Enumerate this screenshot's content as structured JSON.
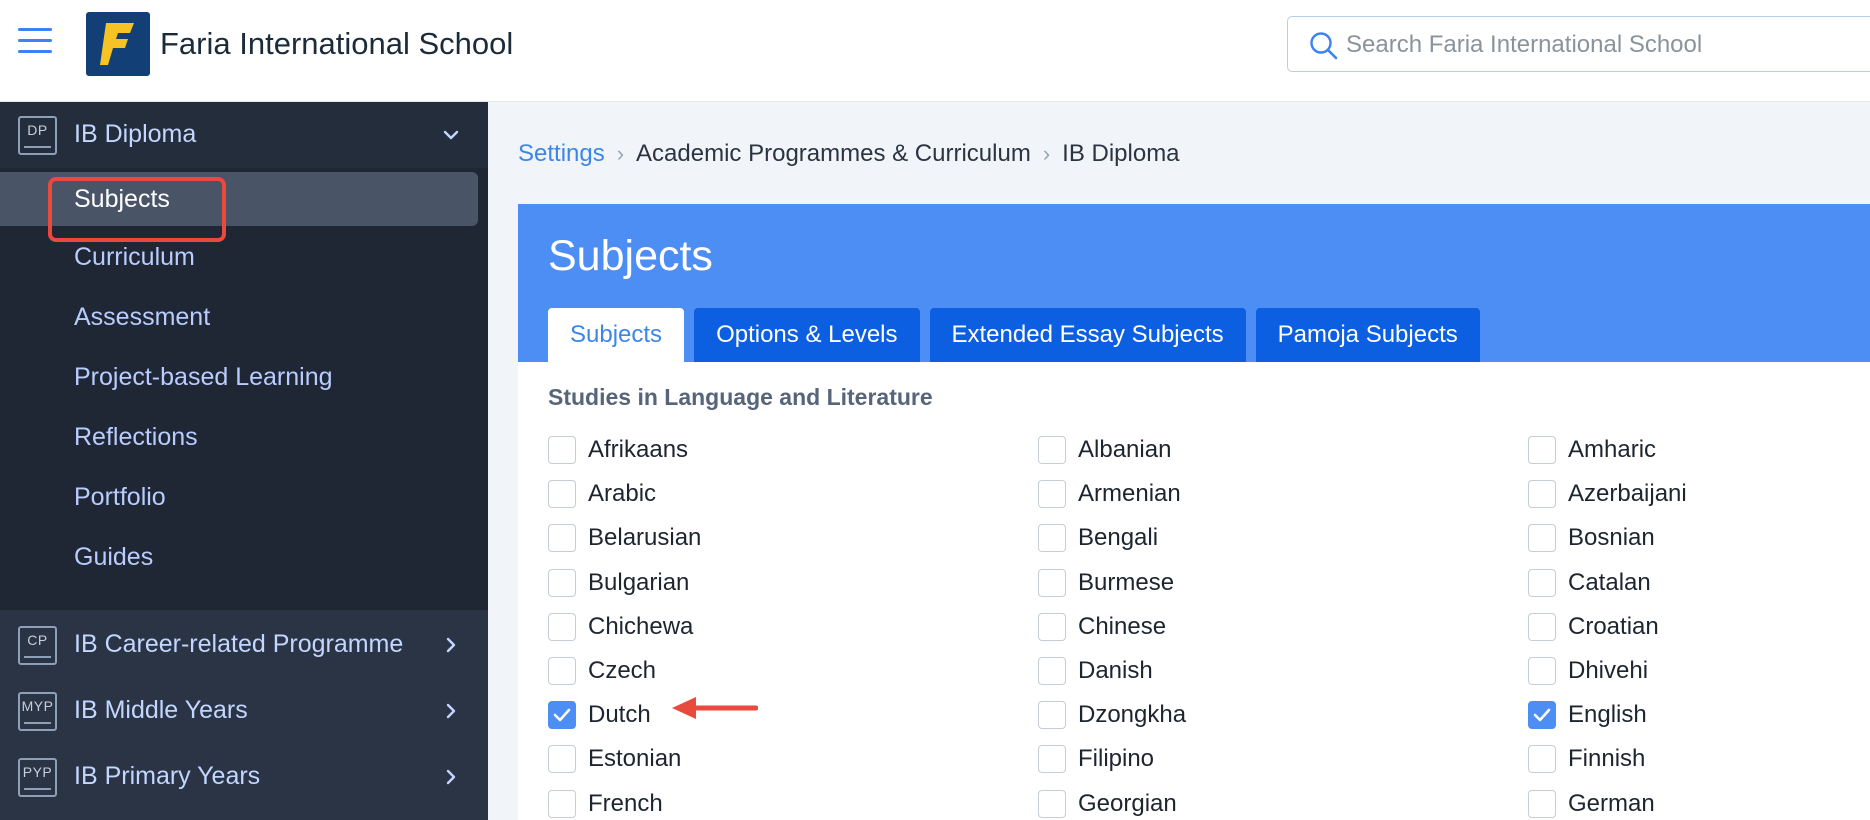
{
  "header": {
    "school_name": "Faria International School",
    "search_placeholder": "Search Faria International School"
  },
  "sidebar": {
    "programmes": [
      {
        "badge": "DP",
        "label": "IB Diploma",
        "expanded": true
      },
      {
        "badge": "CP",
        "label": "IB Career-related Programme",
        "expanded": false
      },
      {
        "badge": "MYP",
        "label": "IB Middle Years",
        "expanded": false
      },
      {
        "badge": "PYP",
        "label": "IB Primary Years",
        "expanded": false
      }
    ],
    "diploma_items": [
      "Subjects",
      "Curriculum",
      "Assessment",
      "Project-based Learning",
      "Reflections",
      "Portfolio",
      "Guides"
    ],
    "active_item": "Subjects"
  },
  "breadcrumb": {
    "items": [
      "Settings",
      "Academic Programmes & Curriculum",
      "IB Diploma"
    ]
  },
  "panel": {
    "title": "Subjects",
    "tabs": [
      "Subjects",
      "Options & Levels",
      "Extended Essay Subjects",
      "Pamoja Subjects"
    ],
    "active_tab": "Subjects",
    "section_title": "Studies in Language and Literature",
    "columns": [
      [
        {
          "label": "Afrikaans",
          "checked": false
        },
        {
          "label": "Arabic",
          "checked": false
        },
        {
          "label": "Belarusian",
          "checked": false
        },
        {
          "label": "Bulgarian",
          "checked": false
        },
        {
          "label": "Chichewa",
          "checked": false
        },
        {
          "label": "Czech",
          "checked": false
        },
        {
          "label": "Dutch",
          "checked": true
        },
        {
          "label": "Estonian",
          "checked": false
        },
        {
          "label": "French",
          "checked": false
        }
      ],
      [
        {
          "label": "Albanian",
          "checked": false
        },
        {
          "label": "Armenian",
          "checked": false
        },
        {
          "label": "Bengali",
          "checked": false
        },
        {
          "label": "Burmese",
          "checked": false
        },
        {
          "label": "Chinese",
          "checked": false
        },
        {
          "label": "Danish",
          "checked": false
        },
        {
          "label": "Dzongkha",
          "checked": false
        },
        {
          "label": "Filipino",
          "checked": false
        },
        {
          "label": "Georgian",
          "checked": false
        }
      ],
      [
        {
          "label": "Amharic",
          "checked": false
        },
        {
          "label": "Azerbaijani",
          "checked": false
        },
        {
          "label": "Bosnian",
          "checked": false
        },
        {
          "label": "Catalan",
          "checked": false
        },
        {
          "label": "Croatian",
          "checked": false
        },
        {
          "label": "Dhivehi",
          "checked": false
        },
        {
          "label": "English",
          "checked": true
        },
        {
          "label": "Finnish",
          "checked": false
        },
        {
          "label": "German",
          "checked": false
        }
      ]
    ]
  },
  "colors": {
    "accent": "#4d8ef5",
    "tab_dark": "#0b5fe0",
    "sidebar": "#2a3444",
    "annotation": "#ea4a3d"
  },
  "icons": {
    "menu": "hamburger-menu-icon",
    "search": "search-icon",
    "expanded": "chevron-down-icon",
    "collapsed": "chevron-right-icon",
    "check": "checkmark-icon"
  }
}
